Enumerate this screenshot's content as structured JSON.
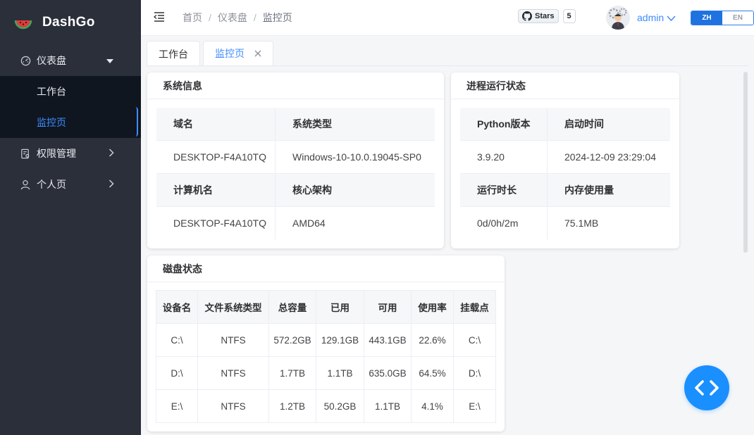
{
  "app": {
    "name": "DashGo"
  },
  "sidebar": {
    "groups": [
      {
        "label": "仪表盘",
        "icon": "dashboard-icon",
        "expanded": true,
        "items": [
          {
            "label": "工作台"
          },
          {
            "label": "监控页",
            "active": true
          }
        ]
      },
      {
        "label": "权限管理",
        "icon": "permission-icon",
        "expanded": false
      },
      {
        "label": "个人页",
        "icon": "user-icon",
        "expanded": false
      }
    ]
  },
  "header": {
    "breadcrumb": [
      "首页",
      "仪表盘",
      "监控页"
    ],
    "github": {
      "label": "Stars",
      "count": "5"
    },
    "user": {
      "name": "admin"
    },
    "lang": {
      "zh": "ZH",
      "en": "EN",
      "active": "ZH"
    }
  },
  "tabs": [
    {
      "label": "工作台"
    },
    {
      "label": "监控页",
      "active": true,
      "closable": true
    }
  ],
  "system_info": {
    "title": "系统信息",
    "h1": [
      "域名",
      "系统类型"
    ],
    "r1": [
      "DESKTOP-F4A10TQ",
      "Windows-10-10.0.19045-SP0"
    ],
    "h2": [
      "计算机名",
      "核心架构"
    ],
    "r2": [
      "DESKTOP-F4A10TQ",
      "AMD64"
    ]
  },
  "process": {
    "title": "进程运行状态",
    "h1": [
      "Python版本",
      "启动时间"
    ],
    "r1": [
      "3.9.20",
      "2024-12-09 23:29:04"
    ],
    "h2": [
      "运行时长",
      "内存使用量"
    ],
    "r2": [
      "0d/0h/2m",
      "75.1MB"
    ]
  },
  "disk": {
    "title": "磁盘状态",
    "columns": [
      "设备名",
      "文件系统类型",
      "总容量",
      "已用",
      "可用",
      "使用率",
      "挂载点"
    ],
    "rows": [
      [
        "C:\\",
        "NTFS",
        "572.2GB",
        "129.1GB",
        "443.1GB",
        "22.6%",
        "C:\\"
      ],
      [
        "D:\\",
        "NTFS",
        "1.7TB",
        "1.1TB",
        "635.0GB",
        "64.5%",
        "D:\\"
      ],
      [
        "E:\\",
        "NTFS",
        "1.2TB",
        "50.2GB",
        "1.1TB",
        "4.1%",
        "E:\\"
      ]
    ]
  },
  "colors": {
    "accent": "#3f8cff",
    "sidebar": "#2b2f3a",
    "submenu": "#0f1620",
    "fab": "#1a8fff"
  }
}
